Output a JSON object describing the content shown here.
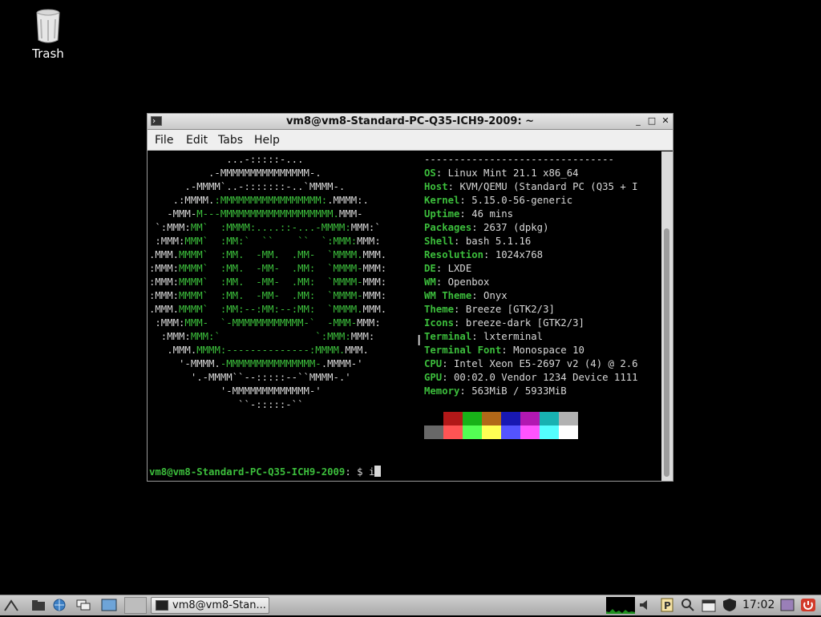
{
  "desktop": {
    "trash_label": "Trash"
  },
  "window": {
    "title": "vm8@vm8-Standard-PC-Q35-ICH9-2009: ~",
    "menu": [
      "File",
      "Edit",
      "Tabs",
      "Help"
    ],
    "controls": {
      "minimize": "_",
      "maximize": "□",
      "close": "✕"
    }
  },
  "terminal": {
    "logo_lines": [
      [
        {
          "t": "             ...-:::::-...",
          "c": "w"
        }
      ],
      [
        {
          "t": "          .-MMMMMMMMMMMMMMM-.",
          "c": "w"
        }
      ],
      [
        {
          "t": "      .-MMMM`..-:::::::-..`MMMM-.",
          "c": "w"
        }
      ],
      [
        {
          "t": "    .:MMMM.",
          "c": "w"
        },
        {
          "t": ":MMMMMMMMMMMMMMMMM:",
          "c": "g"
        },
        {
          "t": ".MMMM:.",
          "c": "w"
        }
      ],
      [
        {
          "t": "   -MMM-",
          "c": "w"
        },
        {
          "t": "M---MMMMMMMMMMMMMMMMMMM.",
          "c": "g"
        },
        {
          "t": "MMM-",
          "c": "w"
        }
      ],
      [
        {
          "t": " `:MMM:",
          "c": "w"
        },
        {
          "t": "MM`  :MMMM:....::-...-MMMM:",
          "c": "g"
        },
        {
          "t": "MMM:`",
          "c": "w"
        }
      ],
      [
        {
          "t": " :MMM:",
          "c": "w"
        },
        {
          "t": "MMM`  :MM:`  ``    ``  `:MMM:",
          "c": "g"
        },
        {
          "t": "MMM:",
          "c": "w"
        }
      ],
      [
        {
          "t": ".MMM.",
          "c": "w"
        },
        {
          "t": "MMMM`  :MM.  -MM.  .MM-  `MMMM.",
          "c": "g"
        },
        {
          "t": "MMM.",
          "c": "w"
        }
      ],
      [
        {
          "t": ":MMM:",
          "c": "w"
        },
        {
          "t": "MMMM`  :MM.  -MM-  .MM:  `MMMM-",
          "c": "g"
        },
        {
          "t": "MMM:",
          "c": "w"
        }
      ],
      [
        {
          "t": ":MMM:",
          "c": "w"
        },
        {
          "t": "MMMM`  :MM.  -MM-  .MM:  `MMMM-",
          "c": "g"
        },
        {
          "t": "MMM:",
          "c": "w"
        }
      ],
      [
        {
          "t": ":MMM:",
          "c": "w"
        },
        {
          "t": "MMMM`  :MM.  -MM-  .MM:  `MMMM-",
          "c": "g"
        },
        {
          "t": "MMM:",
          "c": "w"
        }
      ],
      [
        {
          "t": ".MMM.",
          "c": "w"
        },
        {
          "t": "MMMM`  :MM:--:MM:--:MM:  `MMMM.",
          "c": "g"
        },
        {
          "t": "MMM.",
          "c": "w"
        }
      ],
      [
        {
          "t": " :MMM:",
          "c": "w"
        },
        {
          "t": "MMM-  `-MMMMMMMMMMMM-`  -MMM-",
          "c": "g"
        },
        {
          "t": "MMM:",
          "c": "w"
        }
      ],
      [
        {
          "t": "  :MMM:",
          "c": "w"
        },
        {
          "t": "MMM:`                `:MMM:",
          "c": "g"
        },
        {
          "t": "MMM:",
          "c": "w"
        }
      ],
      [
        {
          "t": "   .MMM.",
          "c": "w"
        },
        {
          "t": "MMMM:--------------:MMMM.",
          "c": "g"
        },
        {
          "t": "MMM.",
          "c": "w"
        }
      ],
      [
        {
          "t": "     '-MMMM.",
          "c": "w"
        },
        {
          "t": "-MMMMMMMMMMMMMMM-",
          "c": "g"
        },
        {
          "t": ".MMMM-'",
          "c": "w"
        }
      ],
      [
        {
          "t": "       '.-MMMM``--:::::--``MMMM-.'",
          "c": "w"
        }
      ],
      [
        {
          "t": "            '-MMMMMMMMMMMMM-'",
          "c": "w"
        }
      ],
      [
        {
          "t": "               ``-:::::-``",
          "c": "w"
        }
      ]
    ],
    "info_separator": "--------------------------------",
    "info": [
      {
        "key": "OS",
        "val": "Linux Mint 21.1 x86_64"
      },
      {
        "key": "Host",
        "val": "KVM/QEMU (Standard PC (Q35 + I"
      },
      {
        "key": "Kernel",
        "val": "5.15.0-56-generic"
      },
      {
        "key": "Uptime",
        "val": "46 mins"
      },
      {
        "key": "Packages",
        "val": "2637 (dpkg)"
      },
      {
        "key": "Shell",
        "val": "bash 5.1.16"
      },
      {
        "key": "Resolution",
        "val": "1024x768"
      },
      {
        "key": "DE",
        "val": "LXDE"
      },
      {
        "key": "WM",
        "val": "Openbox"
      },
      {
        "key": "WM Theme",
        "val": "Onyx"
      },
      {
        "key": "Theme",
        "val": "Breeze [GTK2/3]"
      },
      {
        "key": "Icons",
        "val": "breeze-dark [GTK2/3]"
      },
      {
        "key": "Terminal",
        "val": "lxterminal"
      },
      {
        "key": "Terminal Font",
        "val": "Monospace 10"
      },
      {
        "key": "CPU",
        "val": "Intel Xeon E5-2697 v2 (4) @ 2.6"
      },
      {
        "key": "GPU",
        "val": "00:02.0 Vendor 1234 Device 1111"
      },
      {
        "key": "Memory",
        "val": "563MiB / 5933MiB"
      }
    ],
    "palette_top": [
      "#000000",
      "#b21818",
      "#18b218",
      "#b26818",
      "#1818b2",
      "#b218b2",
      "#18b2b2",
      "#b2b2b2"
    ],
    "palette_bottom": [
      "#686868",
      "#ff5454",
      "#54ff54",
      "#ffff54",
      "#5454ff",
      "#ff54ff",
      "#54ffff",
      "#ffffff"
    ],
    "prompt_user": "vm8@vm8-Standard-PC-Q35-ICH9-2009",
    "prompt_suffix": ": $ ",
    "typed": "i"
  },
  "taskbar": {
    "task_label": "vm8@vm8-Stan...",
    "clock": "17:02"
  }
}
